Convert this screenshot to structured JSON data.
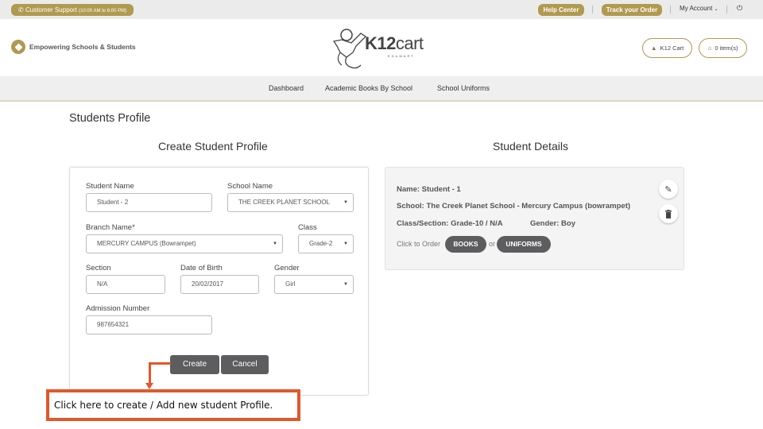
{
  "topbar": {
    "support_label": "Customer Support",
    "support_hours": "(10:00 AM to 6:00 PM)",
    "help_center": "Help Center",
    "track_order": "Track your Order",
    "my_account": "My Account",
    "power_icon": "power-icon"
  },
  "header": {
    "tagline": "Empowering Schools & Students",
    "logo_text_bold": "K12",
    "logo_text": "cart",
    "logo_sub": "EDUMART",
    "cart_user_label": "K12 Cart",
    "cart_items_label": "0 item(s)"
  },
  "nav": {
    "items": [
      {
        "label": "Dashboard"
      },
      {
        "label": "Academic Books By School"
      },
      {
        "label": "School Uniforms"
      }
    ]
  },
  "page": {
    "title": "Students Profile",
    "create_title": "Create Student Profile",
    "details_title": "Student Details"
  },
  "form": {
    "student_name": {
      "label": "Student Name",
      "value": "Student - 2"
    },
    "school_name": {
      "label": "School Name",
      "value": "THE CREEK PLANET SCHOOL"
    },
    "branch_name": {
      "label": "Branch Name*",
      "value": "MERCURY CAMPUS (Bowrampet)"
    },
    "class": {
      "label": "Class",
      "value": "Grade-2"
    },
    "section": {
      "label": "Section",
      "value": "N/A"
    },
    "dob": {
      "label": "Date of Birth",
      "value": "20/02/2017"
    },
    "gender": {
      "label": "Gender",
      "value": "Girl"
    },
    "admission": {
      "label": "Admission Number",
      "value": "987654321"
    },
    "create_label": "Create",
    "cancel_label": "Cancel"
  },
  "details": {
    "name": "Name: Student - 1",
    "school": "School: The Creek Planet School - Mercury Campus (bowrampet)",
    "class_section": "Class/Section: Grade-10 / N/A",
    "gender": "Gender: Boy",
    "order_prefix": "Click to Order",
    "books_label": "BOOKS",
    "or_label": "or",
    "uniforms_label": "UNIFORMS"
  },
  "annotation": {
    "text": "Click here to create / Add new student Profile.",
    "color": "#e2572b"
  },
  "colors": {
    "brand_gold": "#b09a50",
    "dark_button": "#5d5d5f"
  }
}
